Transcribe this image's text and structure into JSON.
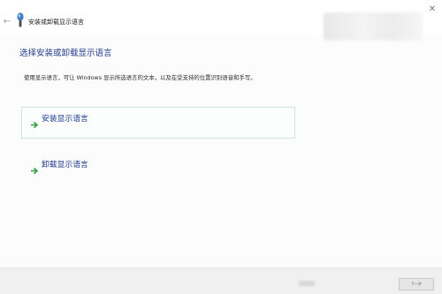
{
  "window": {
    "title": "安装或卸载显示语言"
  },
  "icons": {
    "back": "back-arrow-icon",
    "app": "language-icon",
    "close": "close-icon",
    "option_arrow": "green-arrow-icon"
  },
  "page": {
    "heading": "选择安装或卸载显示语言",
    "description": "使用显示语言，可让 Windows 显示所选语言的文本，以及在受支持的位置识别语音和手写。"
  },
  "options": [
    {
      "label": "安装显示语言"
    },
    {
      "label": "卸载显示语言"
    }
  ],
  "footer": {
    "next_label": "下一步"
  },
  "colors": {
    "link_blue": "#1e3b8a",
    "arrow_green": "#2e9e3e",
    "highlight_border": "#cfe7df",
    "footer_bg": "#f0f0f0"
  }
}
